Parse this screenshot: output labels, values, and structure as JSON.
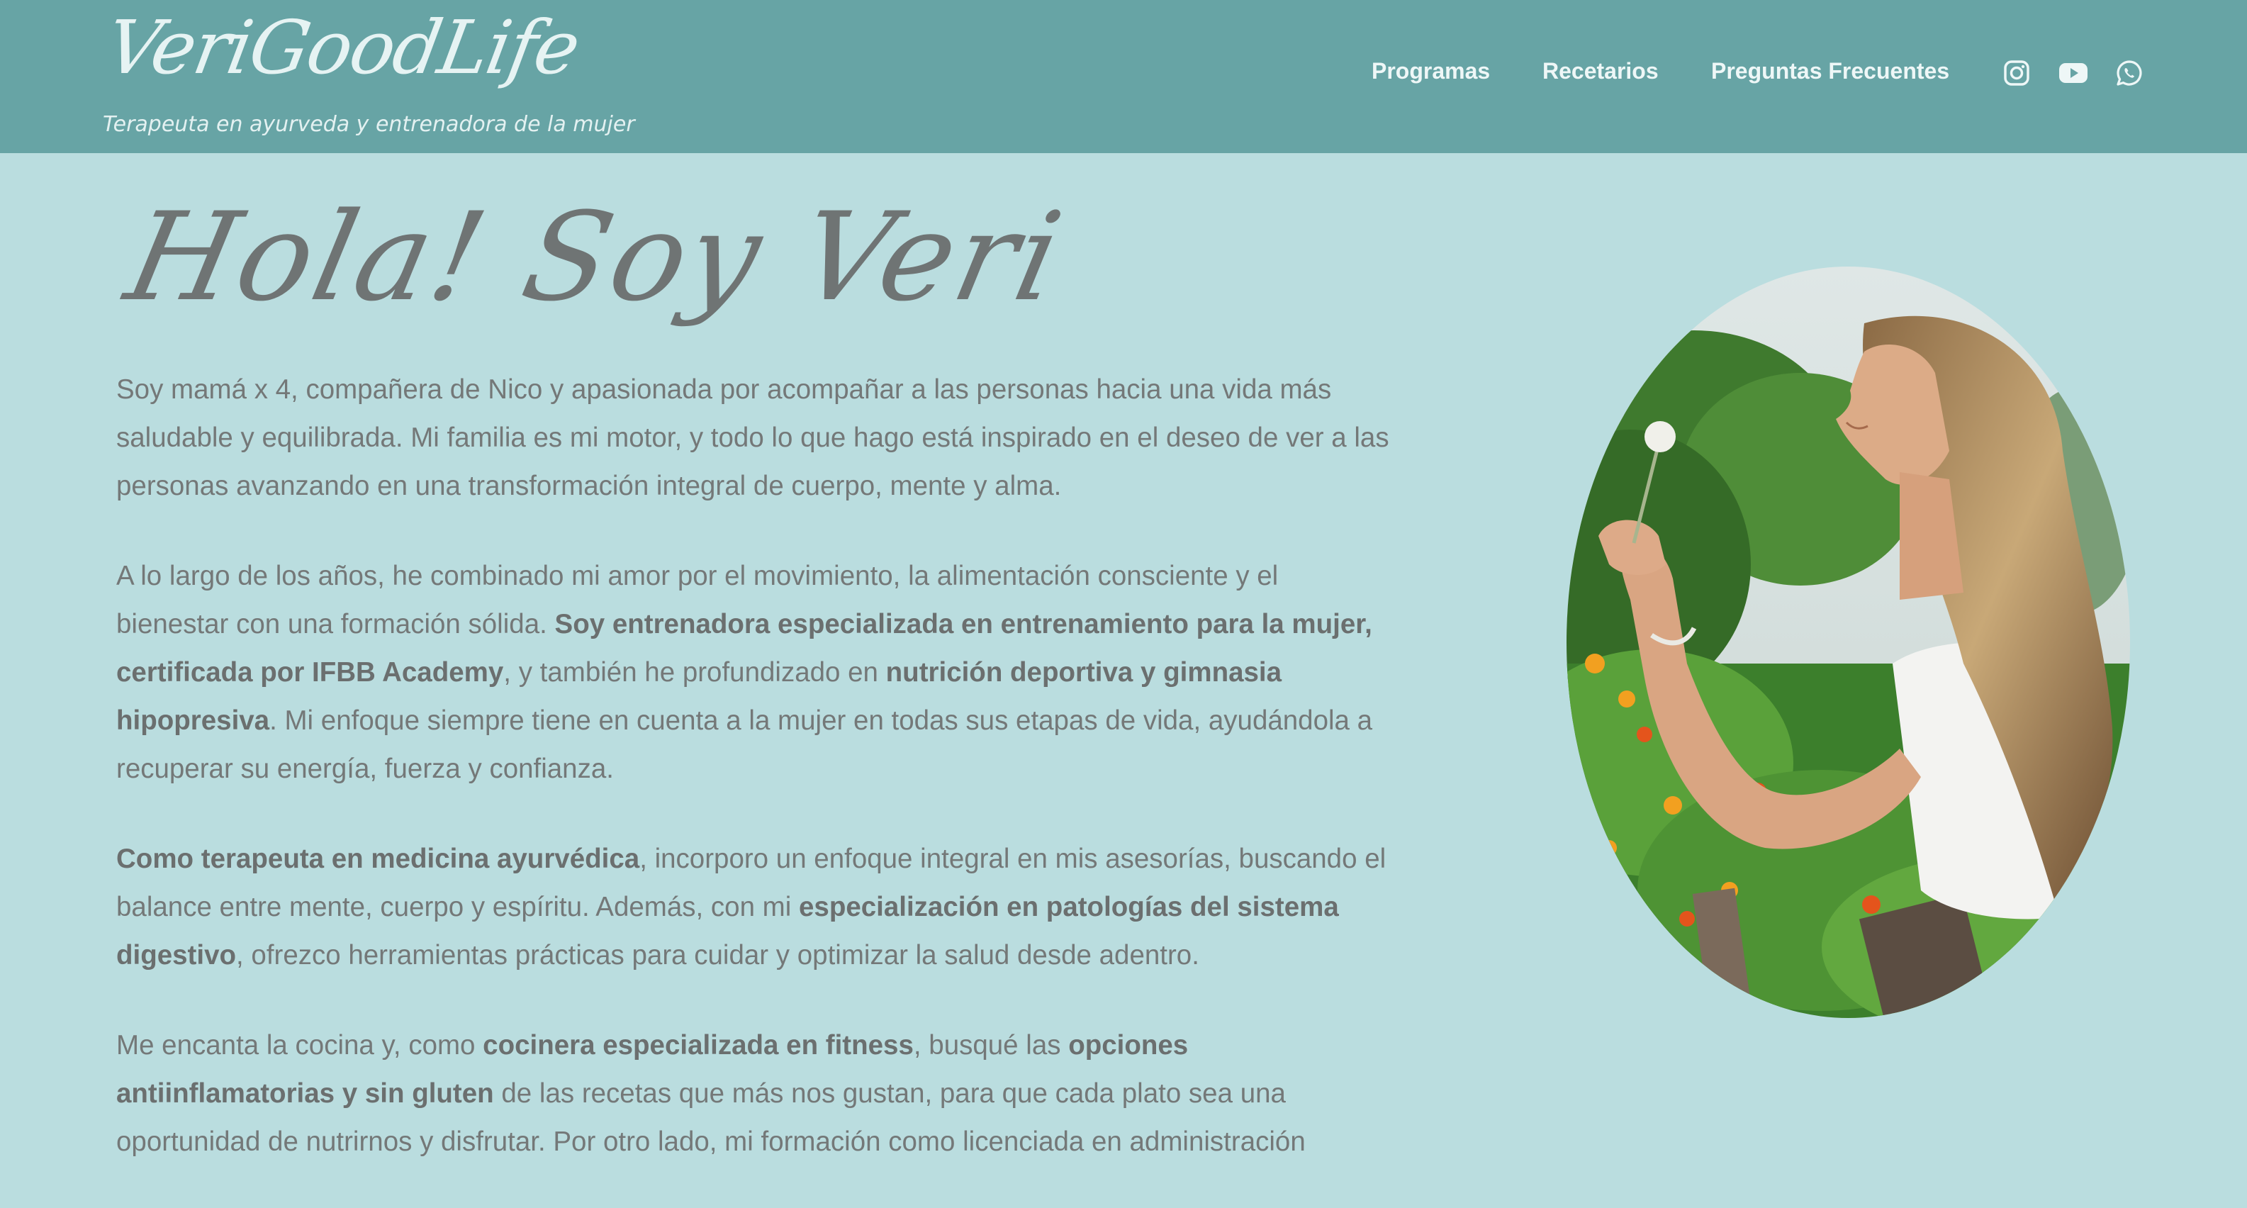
{
  "header": {
    "logo_text": "VeriGoodLife",
    "tagline": "Terapeuta en ayurveda y entrenadora de la mujer",
    "nav": [
      {
        "label": "Programas"
      },
      {
        "label": "Recetarios"
      },
      {
        "label": "Preguntas Frecuentes"
      }
    ],
    "social_icons": [
      "instagram-icon",
      "youtube-icon",
      "whatsapp-icon"
    ]
  },
  "main": {
    "title": "Hola! Soy Veri",
    "paragraphs": [
      [
        {
          "text": "Soy mamá x 4, compañera de Nico y apasionada por acompañar a las personas hacia una vida más saludable y equilibrada. Mi familia es mi motor, y todo lo que hago está inspirado en el deseo de ver a las personas avanzando en una transformación integral de cuerpo, mente y alma."
        }
      ],
      [
        {
          "text": "A lo largo de los años, he combinado mi amor por el movimiento, la alimentación consciente y el bienestar con una formación sólida. "
        },
        {
          "text": "Soy entrenadora especializada en entrenamiento para la mujer, certificada por IFBB Academy",
          "bold": true
        },
        {
          "text": ", y también he profundizado en "
        },
        {
          "text": "nutrición deportiva y gimnasia hipopresiva",
          "bold": true
        },
        {
          "text": ". Mi enfoque siempre tiene en cuenta a la mujer en todas sus etapas de vida, ayudándola a recuperar su energía, fuerza y confianza."
        }
      ],
      [
        {
          "text": "Como terapeuta en medicina ayurvédica",
          "bold": true
        },
        {
          "text": ", incorporo un enfoque integral en mis asesorías, buscando el balance entre mente, cuerpo y espíritu. Además, con mi "
        },
        {
          "text": "especialización en patologías del sistema digestivo",
          "bold": true
        },
        {
          "text": ", ofrezco herramientas prácticas para cuidar y optimizar la salud desde adentro."
        }
      ],
      [
        {
          "text": "Me encanta la cocina y, como "
        },
        {
          "text": "cocinera especializada en fitness",
          "bold": true
        },
        {
          "text": ", busqué las "
        },
        {
          "text": "opciones antiinflamatorias y sin gluten",
          "bold": true
        },
        {
          "text": " de las recetas que más nos gustan, para que cada plato sea una oportunidad de nutrirnos y disfrutar. Por otro lado, mi formación como licenciada en administración"
        }
      ]
    ]
  },
  "colors": {
    "header_bg": "#67a4a5",
    "page_bg": "#badddf",
    "body_text": "#747878",
    "header_text": "#eef7f7"
  }
}
